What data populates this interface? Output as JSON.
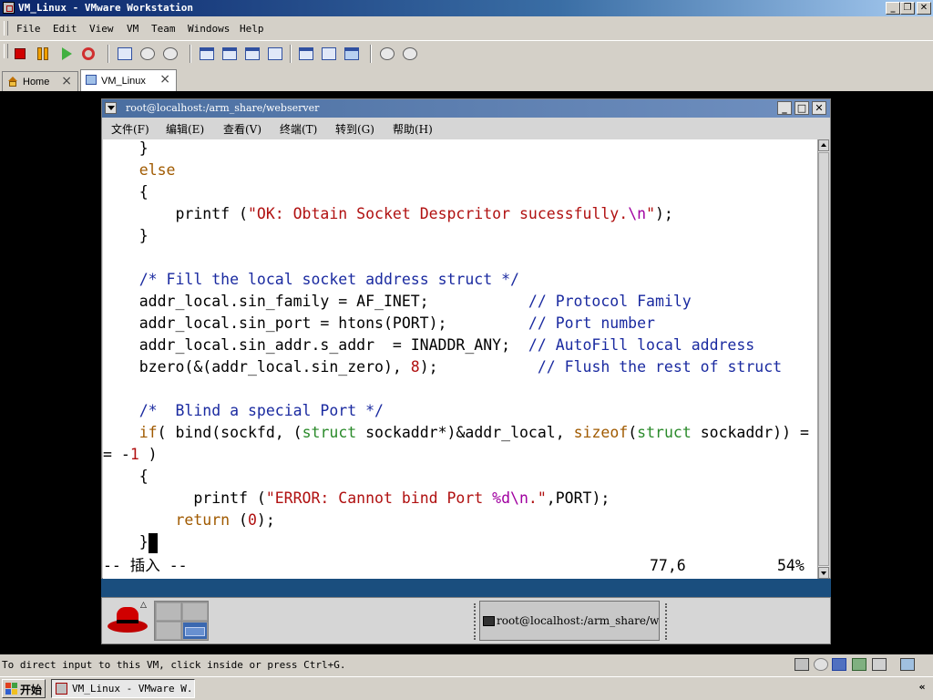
{
  "host": {
    "title": "VM_Linux - VMware Workstation",
    "menu": [
      "File",
      "Edit",
      "View",
      "VM",
      "Team",
      "Windows",
      "Help"
    ],
    "tabs": [
      {
        "label": "Home",
        "icon": "home-icon"
      },
      {
        "label": "VM_Linux",
        "icon": "vm-icon"
      }
    ],
    "caption_buttons": {
      "minimize": "_",
      "restore": "❐",
      "close": "✕"
    },
    "tab_close": "×",
    "status_hint": "To direct input to this VM, click inside or press Ctrl+G."
  },
  "guest": {
    "title": "root@localhost:/arm_share/webserver",
    "menu": [
      "文件(F)",
      "编辑(E)",
      "查看(V)",
      "终端(T)",
      "转到(G)",
      "帮助(H)"
    ],
    "code": [
      [
        {
          "t": "    }"
        }
      ],
      [
        {
          "t": "    "
        },
        {
          "t": "else",
          "c": "kw"
        }
      ],
      [
        {
          "t": "    {"
        }
      ],
      [
        {
          "t": "        printf ("
        },
        {
          "t": "\"OK: Obtain Socket Despcritor sucessfully.",
          "c": "str"
        },
        {
          "t": "\\n",
          "c": "esc"
        },
        {
          "t": "\"",
          "c": "str"
        },
        {
          "t": ");"
        }
      ],
      [
        {
          "t": "    }"
        }
      ],
      [
        {
          "t": ""
        }
      ],
      [
        {
          "t": "    "
        },
        {
          "t": "/* Fill the local socket address struct */",
          "c": "cmt"
        }
      ],
      [
        {
          "t": "    addr_local.sin_family = AF_INET;           "
        },
        {
          "t": "// Protocol Family",
          "c": "cmt"
        }
      ],
      [
        {
          "t": "    addr_local.sin_port = htons(PORT);         "
        },
        {
          "t": "// Port number",
          "c": "cmt"
        }
      ],
      [
        {
          "t": "    addr_local.sin_addr.s_addr  = INADDR_ANY;  "
        },
        {
          "t": "// AutoFill local address",
          "c": "cmt"
        }
      ],
      [
        {
          "t": "    bzero(&(addr_local.sin_zero), "
        },
        {
          "t": "8",
          "c": "num"
        },
        {
          "t": ");           "
        },
        {
          "t": "// Flush the rest of struct",
          "c": "cmt"
        }
      ],
      [
        {
          "t": ""
        }
      ],
      [
        {
          "t": "    "
        },
        {
          "t": "/*  Blind a special Port */",
          "c": "cmt"
        }
      ],
      [
        {
          "t": "    "
        },
        {
          "t": "if",
          "c": "kw"
        },
        {
          "t": "( bind(sockfd, ("
        },
        {
          "t": "struct",
          "c": "ty"
        },
        {
          "t": " sockaddr*)&addr_local, "
        },
        {
          "t": "sizeof",
          "c": "kw"
        },
        {
          "t": "("
        },
        {
          "t": "struct",
          "c": "ty"
        },
        {
          "t": " sockaddr)) ="
        }
      ],
      [
        {
          "t": "= -"
        },
        {
          "t": "1",
          "c": "num"
        },
        {
          "t": " )"
        }
      ],
      [
        {
          "t": "    {"
        }
      ],
      [
        {
          "t": "          printf ("
        },
        {
          "t": "\"ERROR: Cannot bind Port ",
          "c": "str"
        },
        {
          "t": "%d\\n",
          "c": "esc"
        },
        {
          "t": ".\"",
          "c": "str"
        },
        {
          "t": ",PORT);"
        }
      ],
      [
        {
          "t": "        "
        },
        {
          "t": "return",
          "c": "kw"
        },
        {
          "t": " ("
        },
        {
          "t": "0",
          "c": "num"
        },
        {
          "t": ");"
        }
      ],
      [
        {
          "t": "    }"
        },
        {
          "t": "",
          "c": "cursor"
        }
      ]
    ],
    "status": {
      "mode": "-- 插入 --",
      "position": "77,6",
      "percent": "54%"
    },
    "task_label": "root@localhost:/arm_share/webserver"
  },
  "windows_taskbar": {
    "start_label": "开始",
    "task_label": "VM_Linux - VMware W..."
  },
  "colors": {
    "keyword": "#a05a00",
    "type": "#2a8a2a",
    "string": "#b01010",
    "escape": "#a000a0",
    "comment": "#1a2aa0",
    "guest_panel_band": "#1a4e7e"
  }
}
